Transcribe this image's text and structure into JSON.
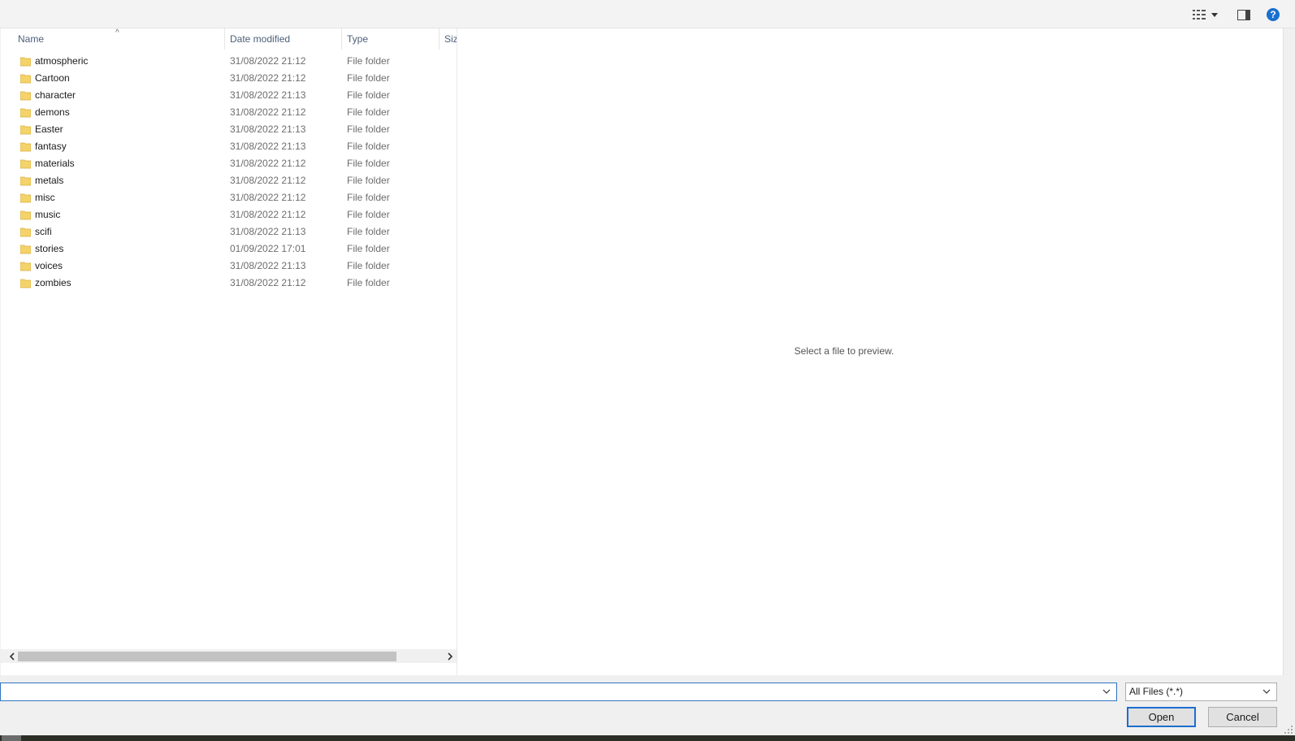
{
  "toolbar": {
    "view_icon": "details-view-icon",
    "preview_icon": "preview-pane-icon",
    "help_icon": "help-icon",
    "help_label": "?"
  },
  "columns": {
    "name": "Name",
    "date": "Date modified",
    "type": "Type",
    "size": "Siz"
  },
  "sort_indicator": "^",
  "files": [
    {
      "name": "atmospheric",
      "date": "31/08/2022 21:12",
      "type": "File folder"
    },
    {
      "name": "Cartoon",
      "date": "31/08/2022 21:12",
      "type": "File folder"
    },
    {
      "name": "character",
      "date": "31/08/2022 21:13",
      "type": "File folder"
    },
    {
      "name": "demons",
      "date": "31/08/2022 21:12",
      "type": "File folder"
    },
    {
      "name": "Easter",
      "date": "31/08/2022 21:13",
      "type": "File folder"
    },
    {
      "name": "fantasy",
      "date": "31/08/2022 21:13",
      "type": "File folder"
    },
    {
      "name": "materials",
      "date": "31/08/2022 21:12",
      "type": "File folder"
    },
    {
      "name": "metals",
      "date": "31/08/2022 21:12",
      "type": "File folder"
    },
    {
      "name": "misc",
      "date": "31/08/2022 21:12",
      "type": "File folder"
    },
    {
      "name": "music",
      "date": "31/08/2022 21:12",
      "type": "File folder"
    },
    {
      "name": "scifi",
      "date": "31/08/2022 21:13",
      "type": "File folder"
    },
    {
      "name": "stories",
      "date": "01/09/2022 17:01",
      "type": "File folder"
    },
    {
      "name": "voices",
      "date": "31/08/2022 21:13",
      "type": "File folder"
    },
    {
      "name": "zombies",
      "date": "31/08/2022 21:12",
      "type": "File folder"
    }
  ],
  "preview": {
    "message": "Select a file to preview."
  },
  "filename": {
    "value": "",
    "placeholder": ""
  },
  "filetype": {
    "selected": "All Files (*.*)"
  },
  "buttons": {
    "open": "Open",
    "cancel": "Cancel"
  },
  "colors": {
    "folder": "#f5d36b",
    "accent": "#1c6ed1",
    "help": "#1a6fd1"
  }
}
